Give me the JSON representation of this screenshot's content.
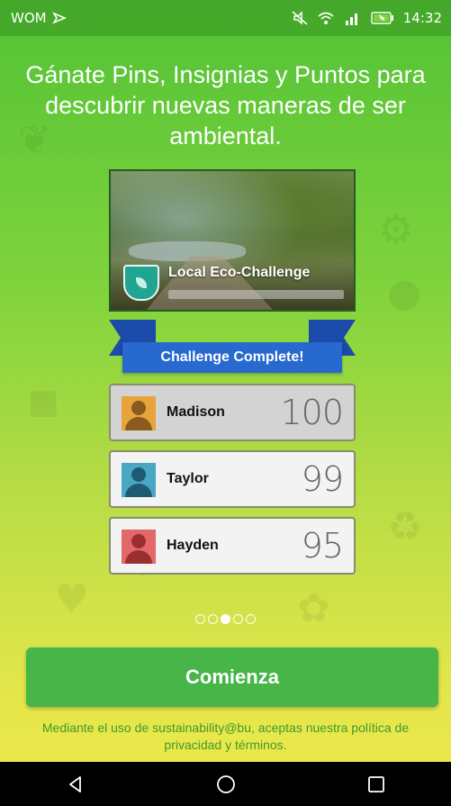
{
  "status_bar": {
    "carrier": "WOM",
    "time": "14:32",
    "icons": [
      "cast-icon",
      "mute-icon",
      "wifi-icon",
      "signal-icon",
      "battery-charging-icon"
    ]
  },
  "headline": "Gánate Pins, Insignias y Puntos para descubrir nuevas maneras de ser ambiental.",
  "challenge_card": {
    "title": "Local Eco-Challenge",
    "badge_icon": "leaf-shield-icon"
  },
  "ribbon_label": "Challenge Complete!",
  "leaderboard": [
    {
      "name": "Madison",
      "score": "100",
      "avatar_color": "#e8a33a",
      "figure_color": "#8a5a1e"
    },
    {
      "name": "Taylor",
      "score": "99",
      "avatar_color": "#49a7c4",
      "figure_color": "#1f5a73"
    },
    {
      "name": "Hayden",
      "score": "95",
      "avatar_color": "#e2686a",
      "figure_color": "#9a2f33"
    }
  ],
  "pager": {
    "count": 5,
    "active_index": 2
  },
  "cta_label": "Comienza",
  "legal_text": "Mediante el uso de sustainability@bu, aceptas nuestra política de privacidad y términos.",
  "nav": {
    "icons": [
      "back-icon",
      "home-icon",
      "recents-icon"
    ]
  },
  "colors": {
    "primary_green": "#47b548",
    "ribbon_blue": "#2869cf",
    "legal_green": "#3f9a2e"
  }
}
